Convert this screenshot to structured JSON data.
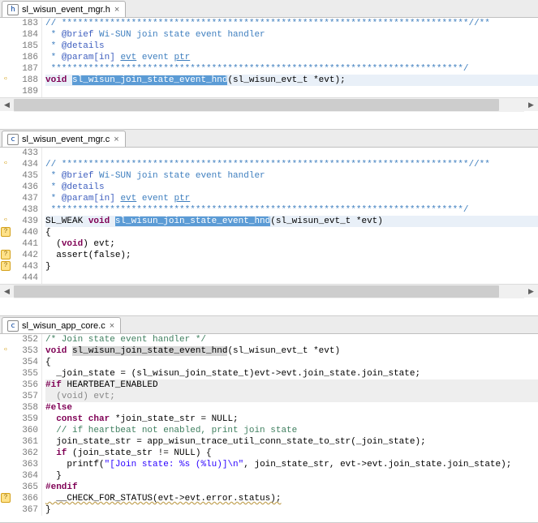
{
  "panes": [
    {
      "tab": {
        "icon": "h",
        "name": "sl_wisun_event_mgr.h"
      },
      "lines": [
        {
          "n": 183,
          "type": "doc",
          "text": "// ****************************************************************************//**"
        },
        {
          "n": 184,
          "type": "doc",
          "brief": " * @brief Wi-SUN join state event handler"
        },
        {
          "n": 185,
          "type": "doc",
          "details": " * @details"
        },
        {
          "n": 186,
          "type": "doc",
          "param": " * @param[in] evt event ptr"
        },
        {
          "n": 187,
          "type": "doc",
          "text": " *****************************************************************************/"
        },
        {
          "n": 188,
          "type": "decl",
          "prefix": "void ",
          "hl": "sl_wisun_join_state_event_hnd",
          "suffix": "(sl_wisun_evt_t *evt);",
          "marker": "arrow",
          "lineHl": true
        },
        {
          "n": 189,
          "type": "blank"
        }
      ],
      "scrollThumb": {
        "left": 0,
        "width": 95
      }
    },
    {
      "tab": {
        "icon": "c",
        "name": "sl_wisun_event_mgr.c"
      },
      "lines": [
        {
          "n": 433,
          "type": "blank"
        },
        {
          "n": 434,
          "type": "doc",
          "text": "// ****************************************************************************//**",
          "marker": "arrow"
        },
        {
          "n": 435,
          "type": "doc",
          "brief": " * @brief Wi-SUN join state event handler"
        },
        {
          "n": 436,
          "type": "doc",
          "details": " * @details"
        },
        {
          "n": 437,
          "type": "doc",
          "param": " * @param[in] evt event ptr"
        },
        {
          "n": 438,
          "type": "doc",
          "text": " *****************************************************************************/"
        },
        {
          "n": 439,
          "type": "def",
          "pre1": "SL_WEAK ",
          "kw": "void ",
          "hl": "sl_wisun_join_state_event_hnd",
          "suffix": "(sl_wisun_evt_t *evt)",
          "marker": "arrow",
          "lineHl": true
        },
        {
          "n": 440,
          "type": "plain",
          "text": "{",
          "marker": "warn"
        },
        {
          "n": 441,
          "type": "voidcast",
          "text": "  (void) evt;"
        },
        {
          "n": 442,
          "type": "plain",
          "text": "  assert(false);",
          "marker": "warn"
        },
        {
          "n": 443,
          "type": "plain",
          "text": "}",
          "marker": "warn"
        },
        {
          "n": 444,
          "type": "blank"
        }
      ],
      "scrollThumb": {
        "left": 0,
        "width": 95
      }
    },
    {
      "tab": {
        "icon": "c",
        "name": "sl_wisun_app_core.c"
      },
      "lines": [
        {
          "n": 352,
          "type": "comment",
          "text": "/* Join state event handler */"
        },
        {
          "n": 353,
          "type": "def2",
          "kw": "void ",
          "hl2": "sl_wisun_join_state_event_hnd",
          "suffix": "(sl_wisun_evt_t *evt)",
          "marker": "arrow"
        },
        {
          "n": 354,
          "type": "plain",
          "text": "{"
        },
        {
          "n": 355,
          "type": "plain",
          "text": "  _join_state = (sl_wisun_join_state_t)evt->evt.join_state.join_state;"
        },
        {
          "n": 356,
          "type": "pp",
          "text": "#if HEARTBEAT_ENABLED",
          "grey": true
        },
        {
          "n": 357,
          "type": "greycast",
          "text": "  (void) evt;",
          "grey": true
        },
        {
          "n": 358,
          "type": "pp",
          "text": "#else"
        },
        {
          "n": 359,
          "type": "constchar",
          "pre": "  ",
          "kw": "const char ",
          "rest": "*join_state_str = NULL;"
        },
        {
          "n": 360,
          "type": "linecomment",
          "text": "  // if heartbeat not enabled, print join state"
        },
        {
          "n": 361,
          "type": "plain",
          "text": "  join_state_str = app_wisun_trace_util_conn_state_to_str(_join_state);"
        },
        {
          "n": 362,
          "type": "if",
          "pre": "  ",
          "kw": "if ",
          "rest": "(join_state_str != NULL) {"
        },
        {
          "n": 363,
          "type": "printf",
          "pre": "    printf(",
          "str": "\"[Join state: %s (%lu)]\\n\"",
          "rest": ", join_state_str, evt->evt.join_state.join_state);"
        },
        {
          "n": 364,
          "type": "plain",
          "text": "  }"
        },
        {
          "n": 365,
          "type": "pp",
          "text": "#endif"
        },
        {
          "n": 366,
          "type": "wavy",
          "text": "  __CHECK_FOR_STATUS(evt->evt.error.status);",
          "marker": "warn"
        },
        {
          "n": 367,
          "type": "plain",
          "text": "}"
        }
      ]
    }
  ]
}
